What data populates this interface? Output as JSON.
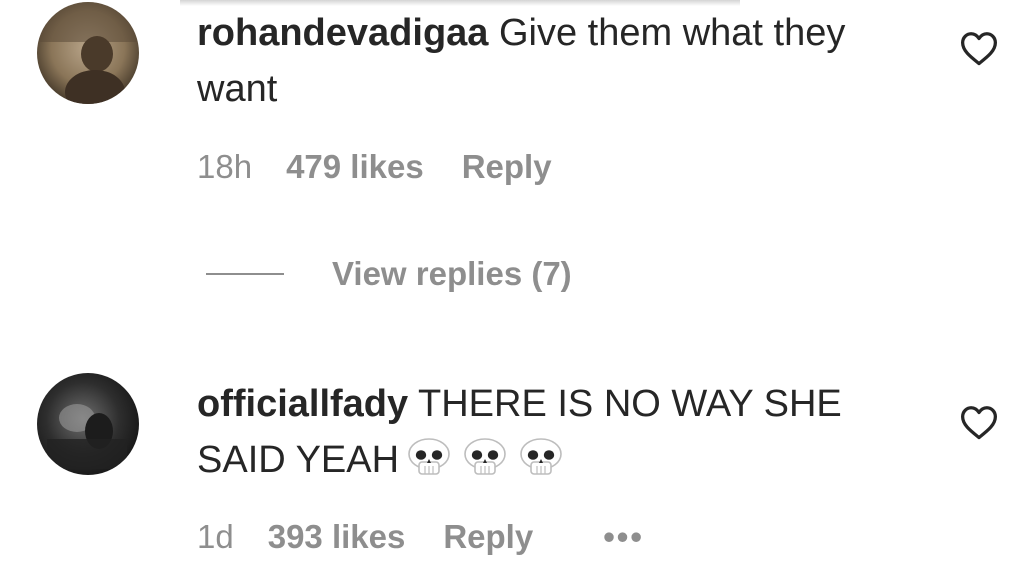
{
  "comments": [
    {
      "username": "rohandevadigaa",
      "text": "Give them what they want",
      "age": "18h",
      "likes": "479 likes",
      "reply_label": "Reply",
      "like_icon": "heart-outline-icon"
    },
    {
      "username": "officiallfady",
      "text": "THERE IS NO WAY SHE SAID YEAH",
      "emoji": [
        "skull-emoji",
        "skull-emoji",
        "skull-emoji"
      ],
      "age": "1d",
      "likes": "393 likes",
      "reply_label": "Reply",
      "more_label": "•••",
      "like_icon": "heart-outline-icon"
    }
  ],
  "view_replies": {
    "label": "View replies (7)"
  },
  "colors": {
    "text": "#262626",
    "secondary": "#8e8e8e",
    "background": "#ffffff"
  }
}
